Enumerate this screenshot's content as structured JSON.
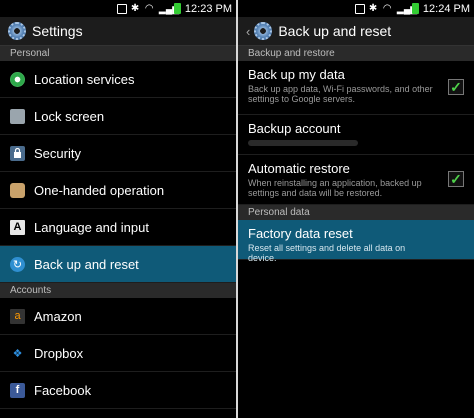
{
  "left": {
    "status_time": "12:23 PM",
    "title": "Settings",
    "sections": [
      {
        "header": "Personal",
        "items": [
          {
            "label": "Location services",
            "icon": "location-icon"
          },
          {
            "label": "Lock screen",
            "icon": "lock-screen-icon"
          },
          {
            "label": "Security",
            "icon": "security-icon"
          },
          {
            "label": "One-handed operation",
            "icon": "one-handed-icon"
          },
          {
            "label": "Language and input",
            "icon": "language-icon"
          },
          {
            "label": "Back up and reset",
            "icon": "backup-icon",
            "selected": true
          }
        ]
      },
      {
        "header": "Accounts",
        "items": [
          {
            "label": "Amazon",
            "icon": "amazon-icon"
          },
          {
            "label": "Dropbox",
            "icon": "dropbox-icon"
          },
          {
            "label": "Facebook",
            "icon": "facebook-icon"
          }
        ]
      }
    ]
  },
  "right": {
    "status_time": "12:24 PM",
    "title": "Back up and reset",
    "sections": [
      {
        "header": "Backup and restore",
        "items": [
          {
            "title": "Back up my data",
            "desc": "Back up app data, Wi-Fi passwords, and other settings to Google servers.",
            "checked": true
          },
          {
            "title": "Backup account",
            "desc": ""
          },
          {
            "title": "Automatic restore",
            "desc": "When reinstalling an application, backed up settings and data will be restored.",
            "checked": true
          }
        ]
      },
      {
        "header": "Personal data",
        "items": [
          {
            "title": "Factory data reset",
            "desc": "Reset all settings and delete all data on device.",
            "selected": true
          }
        ]
      }
    ]
  },
  "icons": {
    "checkmark": "✓",
    "back": "‹"
  },
  "colors": {
    "selected_bg": "#0f5a78",
    "header_bg": "#2a2a2a",
    "check_green": "#4fd14a",
    "battery_green": "#33cc33"
  }
}
